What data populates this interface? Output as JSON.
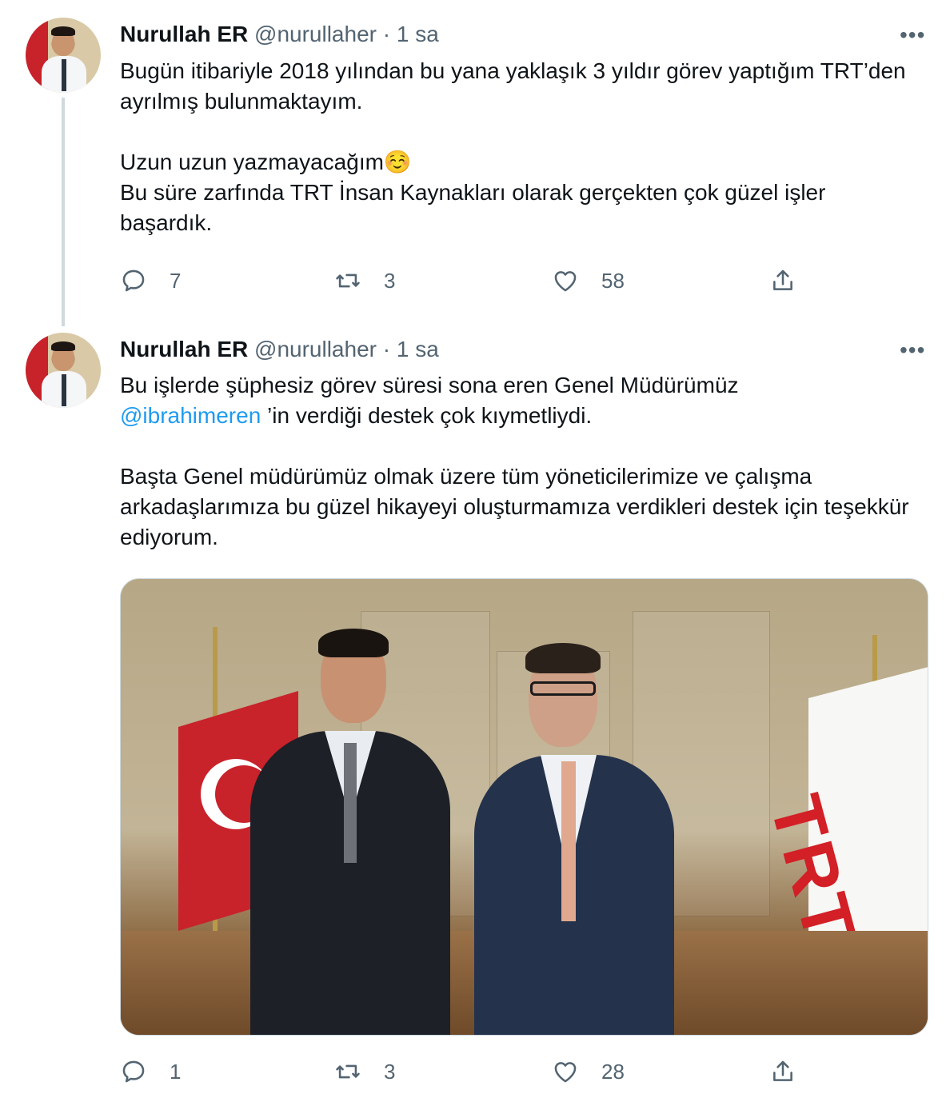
{
  "tweets": [
    {
      "author_name": "Nurullah ER",
      "handle": "@nurullaher",
      "separator": "·",
      "time": "1 sa",
      "more": "•••",
      "paragraphs": [
        "Bugün itibariyle 2018 yılından bu yana yaklaşık 3 yıldır görev yaptığım TRT’den ayrılmış bulunmaktayım.",
        "Uzun uzun yazmayacağım☺️",
        "Bu süre zarfında TRT İnsan Kaynakları olarak gerçekten çok güzel işler başardık."
      ],
      "replies": "7",
      "retweets": "3",
      "likes": "58"
    },
    {
      "author_name": "Nurullah ER",
      "handle": "@nurullaher",
      "separator": "·",
      "time": "1 sa",
      "more": "•••",
      "line1": "Bu işlerde şüphesiz görev süresi sona eren Genel Müdürümüz",
      "mention": "@ibrahimeren",
      "line2_rest": " ’in verdiği destek çok kıymetliydi.",
      "paragraph2": "Başta Genel müdürümüz olmak üzere tüm yöneticilerimize ve çalışma arkadaşlarımıza bu güzel hikayeyi oluşturmamıza verdikleri destek için teşekkür ediyorum.",
      "photo_flag_text": "TRT",
      "replies": "1",
      "retweets": "3",
      "likes": "28"
    }
  ],
  "colors": {
    "text": "#0f1419",
    "secondary": "#536471",
    "link": "#1d9bf0",
    "thread_line": "#cfd9de"
  },
  "icons": [
    "reply-icon",
    "retweet-icon",
    "like-icon",
    "share-icon",
    "more-icon"
  ]
}
